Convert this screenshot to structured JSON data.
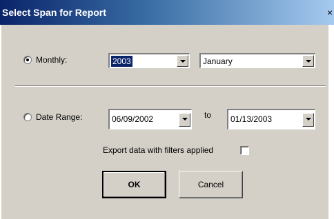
{
  "window": {
    "title": "Select Span for Report",
    "close_glyph": "×"
  },
  "monthly": {
    "label": "Monthly:",
    "checked": true,
    "year_value": "2003",
    "month_value": "January"
  },
  "date_range": {
    "label": "Date Range:",
    "checked": false,
    "from_value": "06/09/2002",
    "to_label": "to",
    "to_value": "01/13/2003"
  },
  "export": {
    "label": "Export data with filters applied",
    "checked": false
  },
  "buttons": {
    "ok_label": "OK",
    "cancel_label": "Cancel"
  },
  "icons": {
    "dropdown": "chevron-down-icon",
    "close": "close-icon"
  },
  "colors": {
    "title_start": "#0a246a",
    "title_end": "#a6caf0",
    "face": "#d4d0c8",
    "selection": "#0a246a"
  }
}
